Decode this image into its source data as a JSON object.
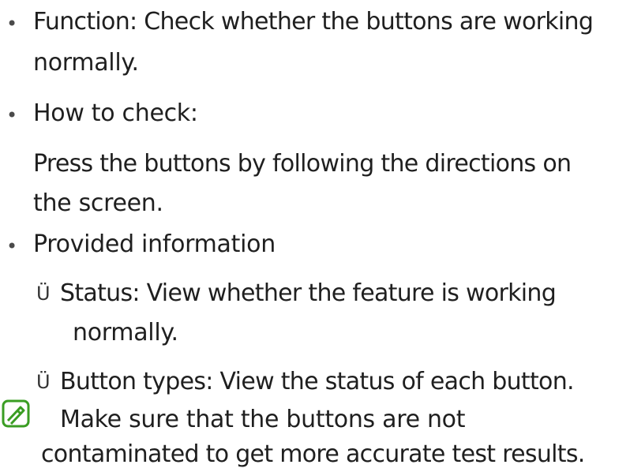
{
  "bullet_char": "•",
  "sub_marker": "Ü",
  "items": [
    {
      "lines": [
        "Function: Check whether the buttons are working",
        "normally."
      ]
    },
    {
      "lines": [
        "How to check:"
      ],
      "continuation": [
        "Press the buttons by following the directions on",
        "the screen."
      ]
    },
    {
      "lines": [
        "Provided information"
      ],
      "subitems": [
        {
          "lines": [
            "Status: View whether the feature is working",
            "normally."
          ]
        },
        {
          "lines": [
            "Button types: View the status of each button."
          ]
        }
      ]
    }
  ],
  "note": {
    "icon": "note-icon",
    "accent_color": "#3a9d23",
    "lines": [
      "Make sure that the buttons are not",
      "contaminated to get more accurate test results."
    ]
  }
}
